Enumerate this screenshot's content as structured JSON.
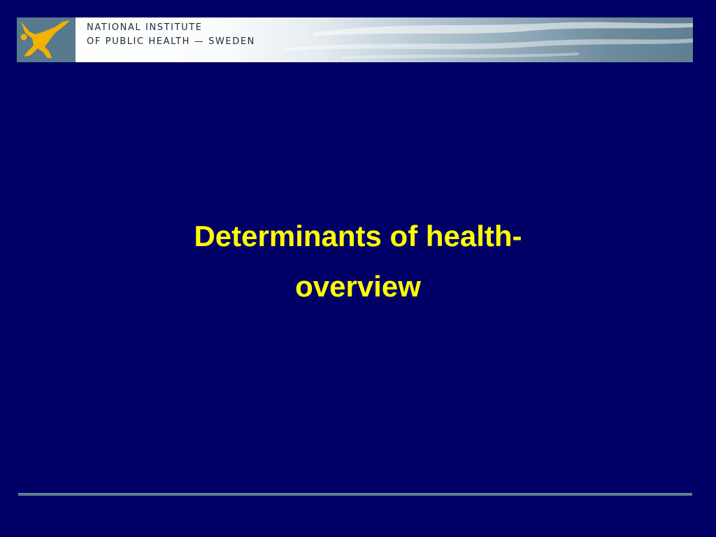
{
  "header": {
    "org_line1": "NATIONAL INSTITUTE",
    "org_line2": "OF PUBLIC HEALTH — SWEDEN",
    "logo_icon": "leaping-figure-icon",
    "logo_color": "#f2b200",
    "banner_accent": "#587a8c"
  },
  "slide": {
    "title_line1": "Determinants of health-",
    "title_line2": "overview",
    "title_color": "#ffff00",
    "background_color": "#000066"
  }
}
